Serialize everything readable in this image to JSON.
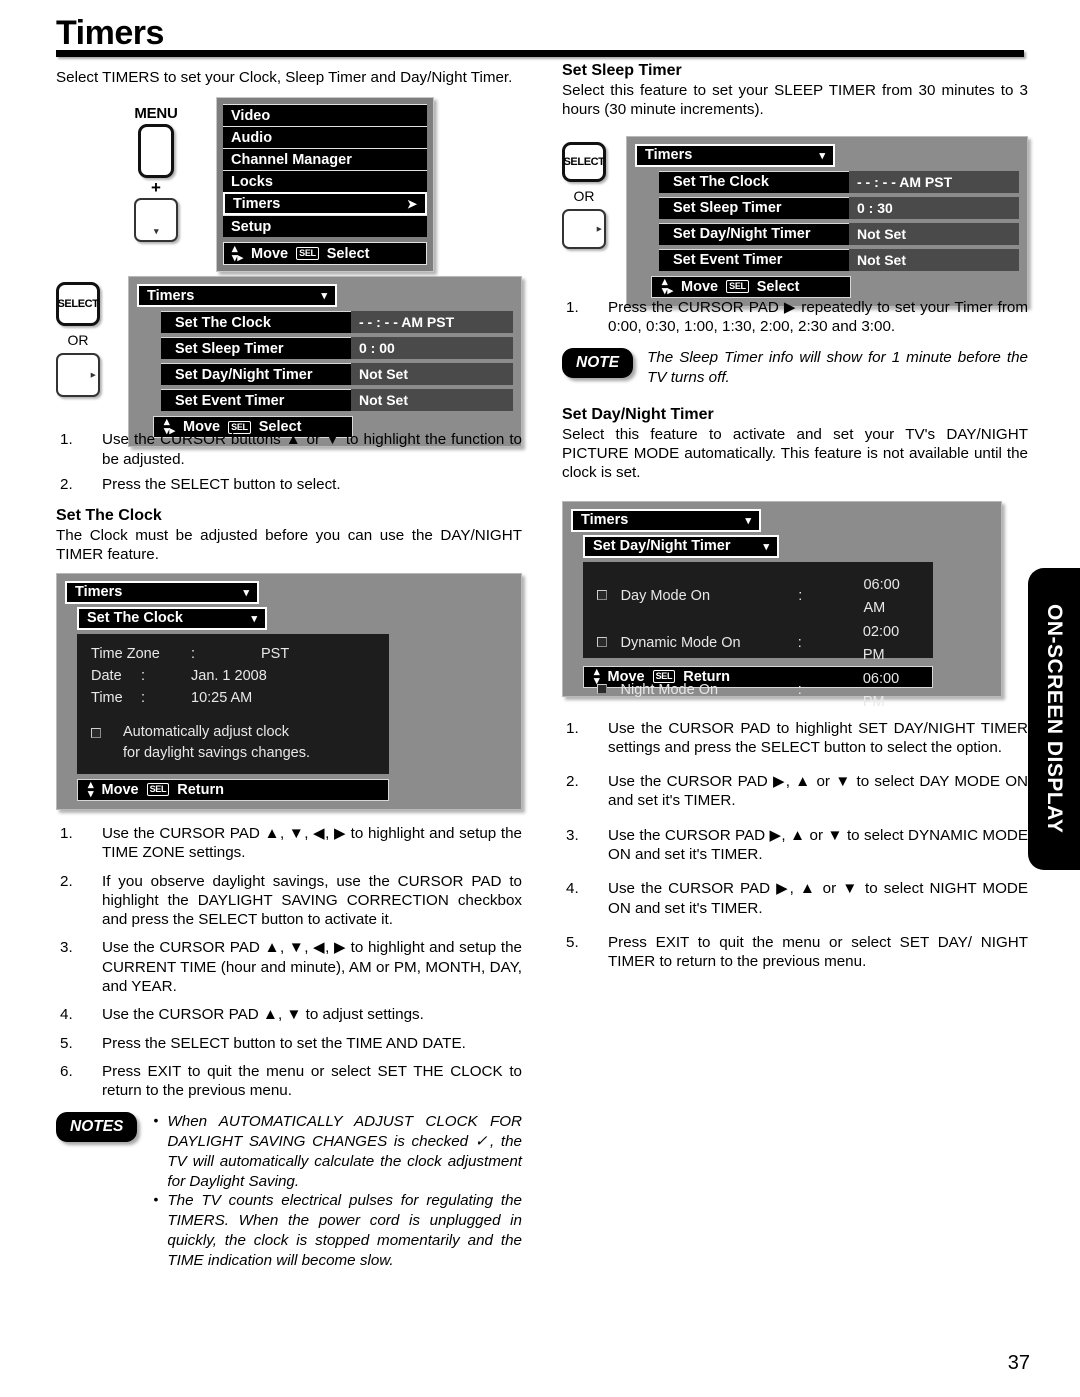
{
  "header": {
    "title": "Timers"
  },
  "page_number": "37",
  "side_tab": {
    "label": "ON-SCREEN DISPLAY"
  },
  "left": {
    "intro": "Select TIMERS to set your Clock, Sleep Timer and Day/Night Timer.",
    "menu_button": {
      "label": "MENU",
      "plus": "+",
      "down_glyph": "▾"
    },
    "main_menu": {
      "items": [
        {
          "label": "Video",
          "selected": false,
          "arrow": ""
        },
        {
          "label": "Audio",
          "selected": false,
          "arrow": ""
        },
        {
          "label": "Channel Manager",
          "selected": false,
          "arrow": ""
        },
        {
          "label": "Locks",
          "selected": false,
          "arrow": ""
        },
        {
          "label": "Timers",
          "selected": true,
          "arrow": "➤"
        },
        {
          "label": "Setup",
          "selected": false,
          "arrow": ""
        }
      ],
      "footer": {
        "move": "Move",
        "sel_key": "SEL",
        "select": "Select"
      }
    },
    "select_button": {
      "label": "SELECT",
      "or": "OR",
      "right_glyph": "▸"
    },
    "timers_menu": {
      "title": "Timers",
      "caret": "▾",
      "rows": [
        {
          "label": "Set The Clock",
          "value": "- - : - - AM PST"
        },
        {
          "label": "Set Sleep Timer",
          "value": "0 : 00"
        },
        {
          "label": "Set Day/Night Timer",
          "value": "Not Set"
        },
        {
          "label": "Set Event Timer",
          "value": "Not Set"
        }
      ],
      "footer": {
        "move": "Move",
        "sel_key": "SEL",
        "select": "Select"
      }
    },
    "steps_1": [
      "Use the CURSOR buttons ▲ or ▼ to highlight the function to be adjusted.",
      "Press the SELECT button to select."
    ],
    "set_clock": {
      "heading": "Set The Clock",
      "body": "The Clock must be adjusted before you can use the DAY/NIGHT TIMER feature.",
      "menu": {
        "title": "Timers",
        "caret": "▾",
        "sub_title": "Set The Clock",
        "sub_caret": "▾",
        "fields": [
          {
            "key": "Time Zone",
            "colon": ":",
            "value": "PST"
          },
          {
            "key": "Date",
            "colon": ":",
            "value": "Jan. 1 2008"
          },
          {
            "key": "Time",
            "colon": ":",
            "value": "10:25 AM"
          }
        ],
        "checkbox_line1": "Automatically adjust clock",
        "checkbox_line2": "for daylight savings changes.",
        "footer": {
          "move": "Move",
          "sel_key": "SEL",
          "return": "Return"
        }
      }
    },
    "steps_2": [
      "Use the CURSOR PAD ▲, ▼, ◀, ▶ to highlight and setup the TIME ZONE settings.",
      "If you observe daylight savings, use the CURSOR PAD to highlight the DAYLIGHT SAVING CORRECTION checkbox and press the SELECT button to activate it.",
      "Use the CURSOR PAD ▲, ▼, ◀, ▶ to highlight and setup the CURRENT TIME (hour and minute), AM or PM, MONTH, DAY, and YEAR.",
      "Use the CURSOR PAD ▲, ▼ to adjust settings.",
      "Press the SELECT button to set the TIME AND DATE.",
      "Press EXIT to quit the menu or select SET THE CLOCK to return to the previous menu."
    ],
    "notes": {
      "pill": "NOTES",
      "items": [
        "When AUTOMATICALLY ADJUST CLOCK FOR DAYLIGHT SAVING CHANGES is checked ✓, the TV will automatically calculate the clock adjustment for Daylight Saving.",
        "The TV counts electrical pulses for regulating the TIMERS. When the power cord is unplugged in quickly, the clock is stopped momentarily and the TIME indication will become slow."
      ]
    }
  },
  "right": {
    "sleep": {
      "heading": "Set Sleep Timer",
      "body": "Select this feature to set your SLEEP TIMER from 30 minutes to 3 hours (30 minute increments).",
      "select_button": {
        "label": "SELECT",
        "or": "OR",
        "right_glyph": "▸"
      },
      "menu": {
        "title": "Timers",
        "caret": "▾",
        "rows": [
          {
            "label": "Set The Clock",
            "value": "- - : - - AM PST"
          },
          {
            "label": "Set Sleep Timer",
            "value": "0 : 30"
          },
          {
            "label": "Set Day/Night Timer",
            "value": "Not Set"
          },
          {
            "label": "Set Event Timer",
            "value": "Not Set"
          }
        ],
        "footer": {
          "move": "Move",
          "sel_key": "SEL",
          "select": "Select"
        }
      },
      "steps": [
        "Press the CURSOR PAD ▶ repeatedly to set your Timer from 0:00, 0:30, 1:00, 1:30, 2:00, 2:30 and 3:00."
      ],
      "note": {
        "pill": "NOTE",
        "text": "The Sleep Timer info will show for 1 minute before the TV turns off."
      }
    },
    "daynight": {
      "heading": "Set Day/Night Timer",
      "body": "Select this feature to activate and set your TV's DAY/NIGHT PICTURE MODE automatically. This feature is not available until the clock is set.",
      "menu": {
        "title": "Timers",
        "caret": "▾",
        "sub_title": "Set Day/Night Timer",
        "sub_caret": "▾",
        "rows": [
          {
            "label": "Day  Mode On",
            "colon": ":",
            "value": "06:00 AM"
          },
          {
            "label": "Dynamic Mode On",
            "colon": ":",
            "value": "02:00 PM"
          },
          {
            "label": "Night Mode On",
            "colon": ":",
            "value": "06:00 PM"
          }
        ],
        "footer": {
          "move": "Move",
          "sel_key": "SEL",
          "return": "Return"
        }
      },
      "steps": [
        "Use the CURSOR PAD to highlight SET DAY/NIGHT TIMER settings and press the SELECT button to select the option.",
        "Use the CURSOR PAD ▶, ▲ or ▼ to select DAY MODE ON and set it's TIMER.",
        "Use the CURSOR PAD ▶, ▲ or ▼ to select DYNAMIC MODE ON and set it's TIMER.",
        "Use the CURSOR PAD ▶, ▲ or ▼ to select NIGHT MODE ON and set it's TIMER.",
        "Press EXIT to quit the menu or select SET DAY/ NIGHT TIMER to return to the previous menu."
      ]
    }
  }
}
